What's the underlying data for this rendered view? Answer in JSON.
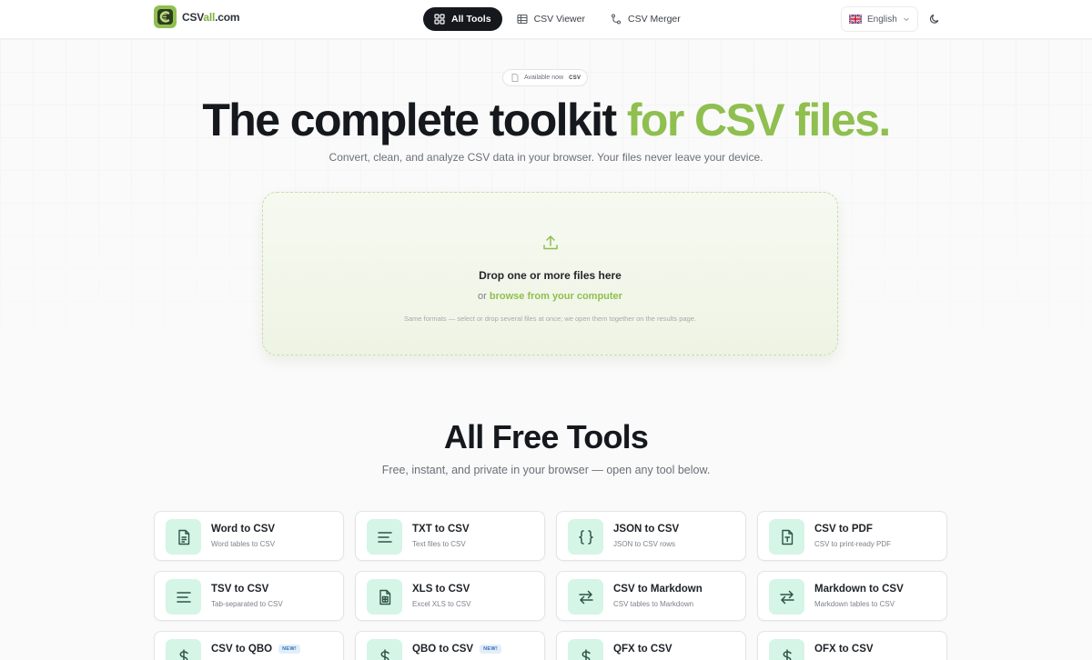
{
  "brand": {
    "prefix": "CSV",
    "accent": "all",
    "suffix": ".com"
  },
  "nav": [
    {
      "label": "All Tools",
      "icon": "grid-icon",
      "active": true
    },
    {
      "label": "CSV Viewer",
      "icon": "table-icon",
      "active": false
    },
    {
      "label": "CSV Merger",
      "icon": "merge-icon",
      "active": false
    }
  ],
  "language": {
    "label": "English",
    "flag": "uk-flag-icon"
  },
  "theme_toggle": {
    "icon": "moon-icon"
  },
  "hero": {
    "badge": {
      "text": "Available now",
      "tag": "CSV"
    },
    "title_dark": "The complete toolkit",
    "title_green": "for CSV files.",
    "subtitle": "Convert, clean, and analyze CSV data in your browser. Your files never leave your device."
  },
  "dropzone": {
    "title": "Drop one or more files here",
    "or": "or",
    "link": "browse from your computer",
    "note": "Same formats — select or drop several files at once; we open them together on the results page."
  },
  "tools_section": {
    "title": "All Free Tools",
    "subtitle": "Free, instant, and private in your browser — open any tool below.",
    "new_label": "NEW!",
    "cards": [
      {
        "title": "Word to CSV",
        "desc": "Word tables to CSV",
        "icon": "document-icon"
      },
      {
        "title": "TXT to CSV",
        "desc": "Text files to CSV",
        "icon": "text-lines-icon"
      },
      {
        "title": "JSON to CSV",
        "desc": "JSON to CSV rows",
        "icon": "braces-icon"
      },
      {
        "title": "CSV to PDF",
        "desc": "CSV to print-ready PDF",
        "icon": "pdf-file-icon"
      },
      {
        "title": "TSV to CSV",
        "desc": "Tab-separated to CSV",
        "icon": "text-lines-icon"
      },
      {
        "title": "XLS to CSV",
        "desc": "Excel XLS to CSV",
        "icon": "spreadsheet-file-icon"
      },
      {
        "title": "CSV to Markdown",
        "desc": "CSV tables to Markdown",
        "icon": "swap-arrows-icon"
      },
      {
        "title": "Markdown to CSV",
        "desc": "Markdown tables to CSV",
        "icon": "swap-arrows-icon"
      },
      {
        "title": "CSV to QBO",
        "desc": "",
        "icon": "dollar-icon",
        "is_new": true
      },
      {
        "title": "QBO to CSV",
        "desc": "",
        "icon": "dollar-icon",
        "is_new": true
      },
      {
        "title": "QFX to CSV",
        "desc": "",
        "icon": "dollar-icon"
      },
      {
        "title": "OFX to CSV",
        "desc": "",
        "icon": "dollar-icon"
      }
    ]
  },
  "colors": {
    "accent": "#8fbf4f",
    "icon_bg": "#d5f5e6",
    "icon_fg": "#2e5546",
    "nav_active": "#15181d"
  }
}
